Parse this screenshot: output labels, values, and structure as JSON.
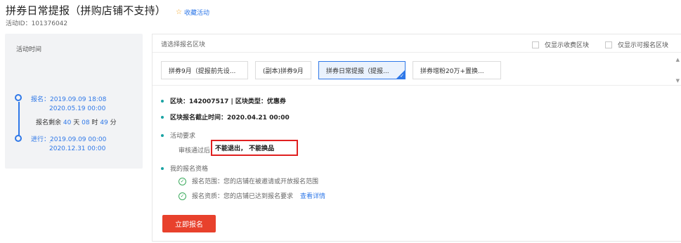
{
  "page": {
    "title": "拼券日常提报（拼购店铺不支持）",
    "favorite_label": "收藏活动",
    "activity_id": "活动ID：101376042"
  },
  "timeline": {
    "title": "活动时间",
    "signup_label": "报名：2019.09.09 18:08",
    "signup_end": "2020.05.19 00:00",
    "remaining_prefix": "报名剩余",
    "remaining_days": "40",
    "days_unit": "天",
    "remaining_hours": "08",
    "hours_unit": "时",
    "remaining_minutes": "49",
    "minutes_unit": "分",
    "run_label": "进行：2019.09.09 00:00",
    "run_dash": "-",
    "run_end": "2020.12.31 00:00"
  },
  "selector": {
    "label": "请选择报名区块",
    "only_fee_label": "仅显示收费区块",
    "only_available_label": "仅显示可报名区块",
    "tabs": [
      {
        "label": "拼券9月（提报前先设..."
      },
      {
        "label": "(副本)拼券9月"
      },
      {
        "label": "拼券日常提报（提报..."
      },
      {
        "label": "拼券增粉20万+置换..."
      }
    ],
    "active_tab": 2
  },
  "block": {
    "info_line": "区块：142007517 | 区块类型：优惠券",
    "deadline_line": "区块报名截止时间：2020.04.21 00:00",
    "requirement_title": "活动要求",
    "requirement_prefix": "审核通过后",
    "requirement_highlight": "不能退出，  不能换品",
    "qualification_title": "我的报名资格",
    "scope_line": "报名范围：您的店铺在被邀请或开放报名范围",
    "qualify_line": "报名资质：您的店铺已达到报名要求",
    "detail_link": "查看详情"
  },
  "actions": {
    "apply_label": "立即报名"
  },
  "colors": {
    "accent": "#2f78e8",
    "primary_button": "#e8412c",
    "highlight_border": "#e02020",
    "bullet": "#1aa3a3",
    "check": "#3aaa5c"
  }
}
